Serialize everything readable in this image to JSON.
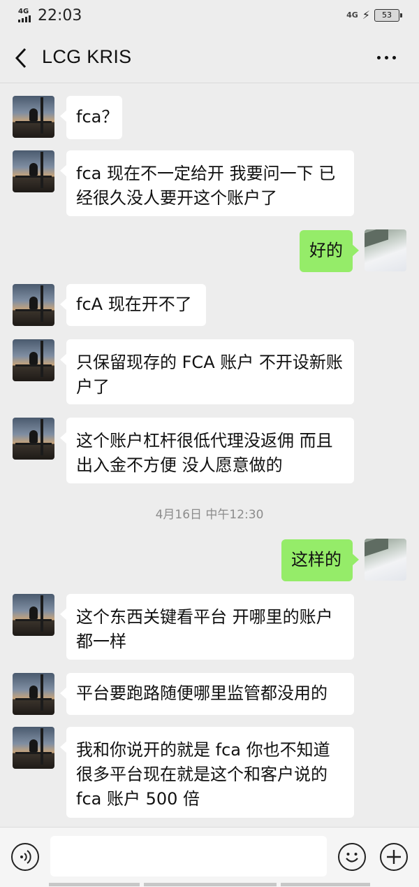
{
  "status_bar": {
    "network": "4G",
    "time": "22:03",
    "network_right": "4G",
    "battery": "53"
  },
  "header": {
    "title": "LCG KRIS"
  },
  "messages": [
    {
      "side": "left",
      "text": "fca？"
    },
    {
      "side": "left",
      "text": "fca 现在不一定给开 我要问一下 已经很久没人要开这个账户了"
    },
    {
      "side": "right",
      "text": "好的"
    },
    {
      "side": "left",
      "text": "fcA 现在开不了"
    },
    {
      "side": "left",
      "text": "只保留现存的 FCA 账户 不开设新账户了"
    },
    {
      "side": "left",
      "text": "这个账户杠杆很低代理没返佣 而且出入金不方便 没人愿意做的"
    },
    {
      "side": "right",
      "text": "这样的"
    },
    {
      "side": "left",
      "text": "这个东西关键看平台 开哪里的账户都一样"
    },
    {
      "side": "left",
      "text": "平台要跑路随便哪里监管都没用的"
    },
    {
      "side": "left",
      "text": "我和你说开的就是 fca 你也不知道很多平台现在就是这个和客户说的 fca 账户 500 倍"
    }
  ],
  "timestamp": "4月16日 中午12:30",
  "input_bar": {
    "voice_icon": "voice-icon",
    "emoji_icon": "emoji-icon",
    "plus_icon": "plus-icon"
  },
  "colors": {
    "background": "#ededed",
    "my_bubble": "#95ec69",
    "their_bubble": "#ffffff"
  }
}
